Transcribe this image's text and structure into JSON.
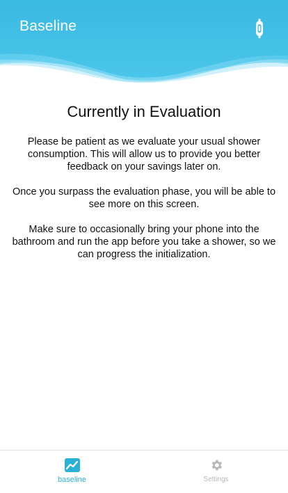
{
  "header": {
    "title": "Baseline",
    "device_icon": "shower-device-icon",
    "color_top": "#3ab9e2",
    "color_bottom": "#5cd0ee"
  },
  "main": {
    "title": "Currently in Evaluation",
    "paragraphs": [
      "Please be patient as we evaluate your usual shower consumption. This will allow us to provide you better feedback on your savings later on.",
      "Once you surpass the evaluation phase, you will be able to see more on this screen.",
      "Make sure to occasionally bring your phone into the bathroom and run the app before you take a shower, so we can progress the initialization."
    ]
  },
  "bottom_nav": {
    "items": [
      {
        "label": "baseline",
        "icon": "chart-icon",
        "active": true,
        "color": "#2bb0d6"
      },
      {
        "label": "Settings",
        "icon": "gear-icon",
        "active": false,
        "color": "#b8b8b8"
      }
    ]
  }
}
